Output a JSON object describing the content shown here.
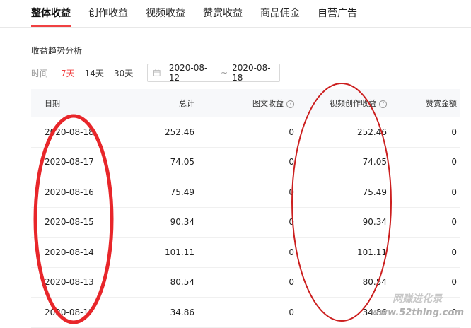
{
  "tabs": [
    {
      "label": "整体收益",
      "active": true
    },
    {
      "label": "创作收益",
      "active": false
    },
    {
      "label": "视频收益",
      "active": false
    },
    {
      "label": "赞赏收益",
      "active": false
    },
    {
      "label": "商品佣金",
      "active": false
    },
    {
      "label": "自营广告",
      "active": false
    }
  ],
  "section_title": "收益趋势分析",
  "range": {
    "label": "时间",
    "options": [
      "7天",
      "14天",
      "30天"
    ],
    "active_option": "7天",
    "date_start": "2020-08-12",
    "date_sep": "~",
    "date_end": "2020-08-18"
  },
  "table": {
    "headers": {
      "date": "日期",
      "total": "总计",
      "image_text": "图文收益",
      "video": "视频创作收益",
      "tip": "赞赏金额"
    },
    "rows": [
      {
        "date": "2020-08-18",
        "total": "252.46",
        "image_text": "0",
        "video": "252.46",
        "tip": "0"
      },
      {
        "date": "2020-08-17",
        "total": "74.05",
        "image_text": "0",
        "video": "74.05",
        "tip": "0"
      },
      {
        "date": "2020-08-16",
        "total": "75.49",
        "image_text": "0",
        "video": "75.49",
        "tip": "0"
      },
      {
        "date": "2020-08-15",
        "total": "90.34",
        "image_text": "0",
        "video": "90.34",
        "tip": "0"
      },
      {
        "date": "2020-08-14",
        "total": "101.11",
        "image_text": "0",
        "video": "101.11",
        "tip": "0"
      },
      {
        "date": "2020-08-13",
        "total": "80.54",
        "image_text": "0",
        "video": "80.54",
        "tip": "0"
      },
      {
        "date": "2020-08-12",
        "total": "34.86",
        "image_text": "0",
        "video": "34.86",
        "tip": "0"
      }
    ]
  },
  "watermark": {
    "brand": "网赚进化录",
    "url": "www.52thing.com"
  },
  "colors": {
    "accent": "#f04142",
    "annotation": "#e8262a"
  }
}
